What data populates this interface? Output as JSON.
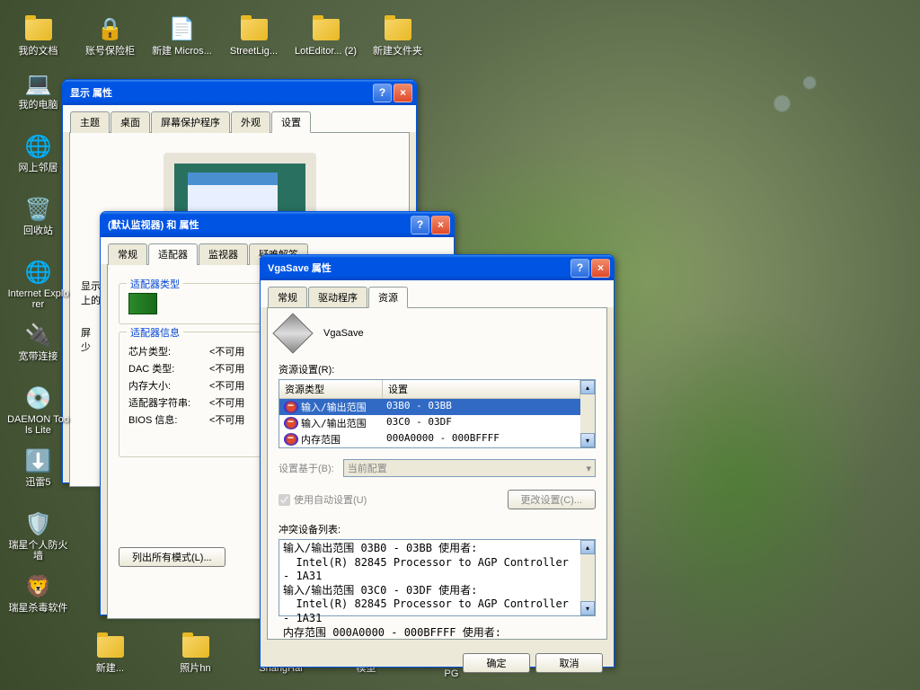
{
  "desktop_icons_row": [
    {
      "label": "我的文档",
      "icon": "📁"
    },
    {
      "label": "账号保险柜",
      "icon": "🔒"
    },
    {
      "label": "新建 Micros...",
      "icon": "📄"
    },
    {
      "label": "StreetLig...",
      "icon": "📁"
    },
    {
      "label": "LotEditor... (2)",
      "icon": "📁"
    },
    {
      "label": "新建文件夹",
      "icon": "📁"
    }
  ],
  "desktop_icons_col": [
    {
      "label": "我的电脑",
      "icon": "💻"
    },
    {
      "label": "网上邻居",
      "icon": "🌐"
    },
    {
      "label": "回收站",
      "icon": "🗑️"
    },
    {
      "label": "Internet Explorer",
      "icon": "🌐"
    },
    {
      "label": "宽带连接",
      "icon": "🔌"
    },
    {
      "label": "DAEMON Tools Lite",
      "icon": "💿"
    },
    {
      "label": "迅雷5",
      "icon": "⬇️"
    },
    {
      "label": "瑞星个人防火墙",
      "icon": "🛡️"
    },
    {
      "label": "瑞星杀毒软件",
      "icon": "🦁"
    }
  ],
  "bottom_icons": [
    {
      "label": "新建..."
    },
    {
      "label": "照片hn"
    },
    {
      "label": "ShangHai"
    },
    {
      "label": "模型"
    },
    {
      "label": "BUS TRAIN.JPG"
    }
  ],
  "win1": {
    "title": "显示 属性",
    "tabs": [
      "主题",
      "桌面",
      "屏幕保护程序",
      "外观",
      "设置"
    ],
    "active_tab": "设置",
    "display_prefix": "显示",
    "display_suffix": "上的",
    "screen_prefix": "屏",
    "screen_suffix": "少"
  },
  "win2": {
    "title": "(默认监视器) 和   属性",
    "tabs": [
      "常规",
      "适配器",
      "监视器",
      "疑难解答"
    ],
    "active_tab": "适配器",
    "adapter_type_title": "适配器类型",
    "adapter_info_title": "适配器信息",
    "info": [
      {
        "label": "芯片类型:",
        "value": "<不可用"
      },
      {
        "label": "DAC 类型:",
        "value": "<不可用"
      },
      {
        "label": "内存大小:",
        "value": "<不可用"
      },
      {
        "label": "适配器字符串:",
        "value": "<不可用"
      },
      {
        "label": "BIOS 信息:",
        "value": "<不可用"
      }
    ],
    "list_modes_btn": "列出所有模式(L)..."
  },
  "win3": {
    "title": "VgaSave 属性",
    "tabs": [
      "常规",
      "驱动程序",
      "资源"
    ],
    "active_tab": "资源",
    "device_name": "VgaSave",
    "resource_settings_label": "资源设置(R):",
    "columns": [
      "资源类型",
      "设置"
    ],
    "rows": [
      {
        "type": "输入/输出范围",
        "setting": "03B0 - 03BB",
        "selected": true
      },
      {
        "type": "输入/输出范围",
        "setting": "03C0 - 03DF",
        "selected": false
      },
      {
        "type": "内存范围",
        "setting": "000A0000 - 000BFFFF",
        "selected": false
      }
    ],
    "setting_based_label": "设置基于(B):",
    "setting_based_value": "当前配置",
    "auto_checkbox": "使用自动设置(U)",
    "change_btn": "更改设置(C)...",
    "conflict_label": "冲突设备列表:",
    "conflict_text": "输入/输出范围 03B0 - 03BB 使用者:\n  Intel(R) 82845 Processor to AGP Controller - 1A31\n输入/输出范围 03C0 - 03DF 使用者:\n  Intel(R) 82845 Processor to AGP Controller - 1A31\n内存范围 000A0000 - 000BFFFF 使用者:",
    "ok_btn": "确定",
    "cancel_btn": "取消"
  }
}
